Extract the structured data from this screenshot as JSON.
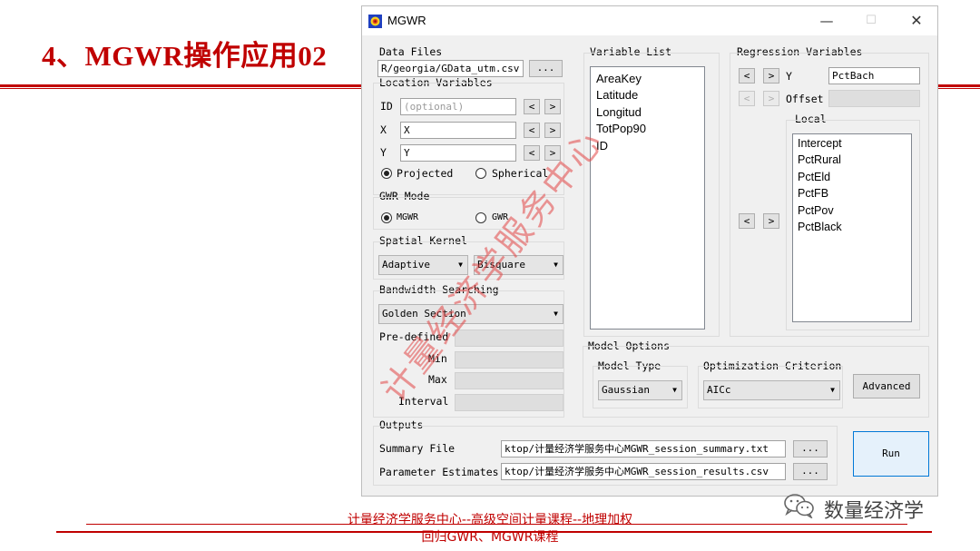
{
  "slide": {
    "title": "4、MGWR操作应用02",
    "footer_line1": "计量经济学服务中心--高级空间计量课程--地理加权",
    "footer_line2": "回归GWR、MGWR课程",
    "wechat_label": "数量经济学",
    "watermark": "计量经济学服务中心"
  },
  "window": {
    "title": "MGWR",
    "controls": {
      "minimize": "—",
      "maximize": "☐",
      "close": "✕"
    }
  },
  "data_files": {
    "label": "Data Files",
    "path": "R/georgia/GData_utm.csv",
    "browse": "..."
  },
  "location": {
    "label": "Location Variables",
    "id_label": "ID",
    "id_placeholder": "(optional)",
    "x_label": "X",
    "x_value": "X",
    "y_label": "Y",
    "y_value": "Y",
    "left": "<",
    "right": ">",
    "projected": "Projected",
    "spherical": "Spherical"
  },
  "gwr_mode": {
    "label": "GWR Mode",
    "mgwr": "MGWR",
    "gwr": "GWR"
  },
  "kernel": {
    "label": "Spatial Kernel",
    "type": "Adaptive",
    "shape": "Bisquare"
  },
  "bandwidth": {
    "label": "Bandwidth Searching",
    "method": "Golden Section",
    "predefined": "Pre-defined",
    "min": "Min",
    "max": "Max",
    "interval": "Interval"
  },
  "variable_list": {
    "label": "Variable List",
    "items": [
      "AreaKey",
      "Latitude",
      "Longitud",
      "TotPop90",
      "ID"
    ]
  },
  "regression": {
    "label": "Regression Variables",
    "y_label": "Y",
    "y_value": "PctBach",
    "offset_label": "Offset",
    "local_label": "Local",
    "local_items": [
      "Intercept",
      "PctRural",
      "PctEld",
      "PctFB",
      "PctPov",
      "PctBlack"
    ]
  },
  "model_options": {
    "label": "Model Options",
    "type_label": "Model Type",
    "type_value": "Gaussian",
    "criterion_label": "Optimization Criterion",
    "criterion_value": "AICc",
    "advanced": "Advanced"
  },
  "outputs": {
    "label": "Outputs",
    "summary_label": "Summary File",
    "summary_path": "ktop/计量经济学服务中心MGWR_session_summary.txt",
    "params_label": "Parameter Estimates",
    "params_path": "ktop/计量经济学服务中心MGWR_session_results.csv",
    "browse": "..."
  },
  "run": "Run",
  "icons": [
    "mgwr-app-icon",
    "wechat-icon"
  ],
  "colors": {
    "accent": "#c00000",
    "run_border": "#0078d7"
  }
}
